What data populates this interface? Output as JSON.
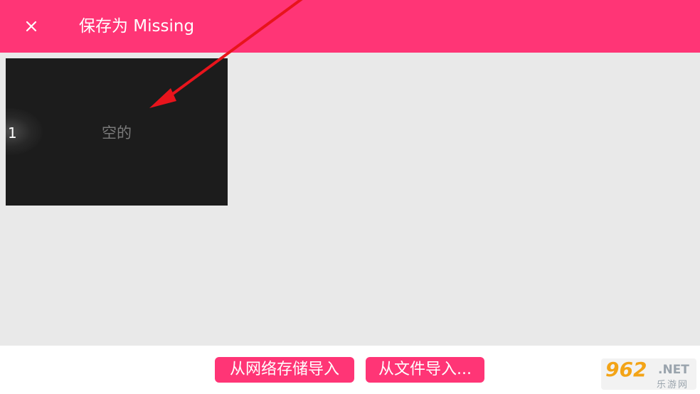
{
  "header": {
    "title": "保存为 Missing",
    "close_icon": "close-icon",
    "background_color": "#ff3576"
  },
  "slots": [
    {
      "number": "1",
      "status": "空的"
    }
  ],
  "footer": {
    "import_network_label": "从网络存储导入",
    "import_file_label": "从文件导入..."
  },
  "annotation": {
    "arrow_color": "#e8141c",
    "icon": "red-arrow-icon"
  },
  "watermark": {
    "digits": "962",
    "suffix": ".NET",
    "cn": "乐游网"
  }
}
